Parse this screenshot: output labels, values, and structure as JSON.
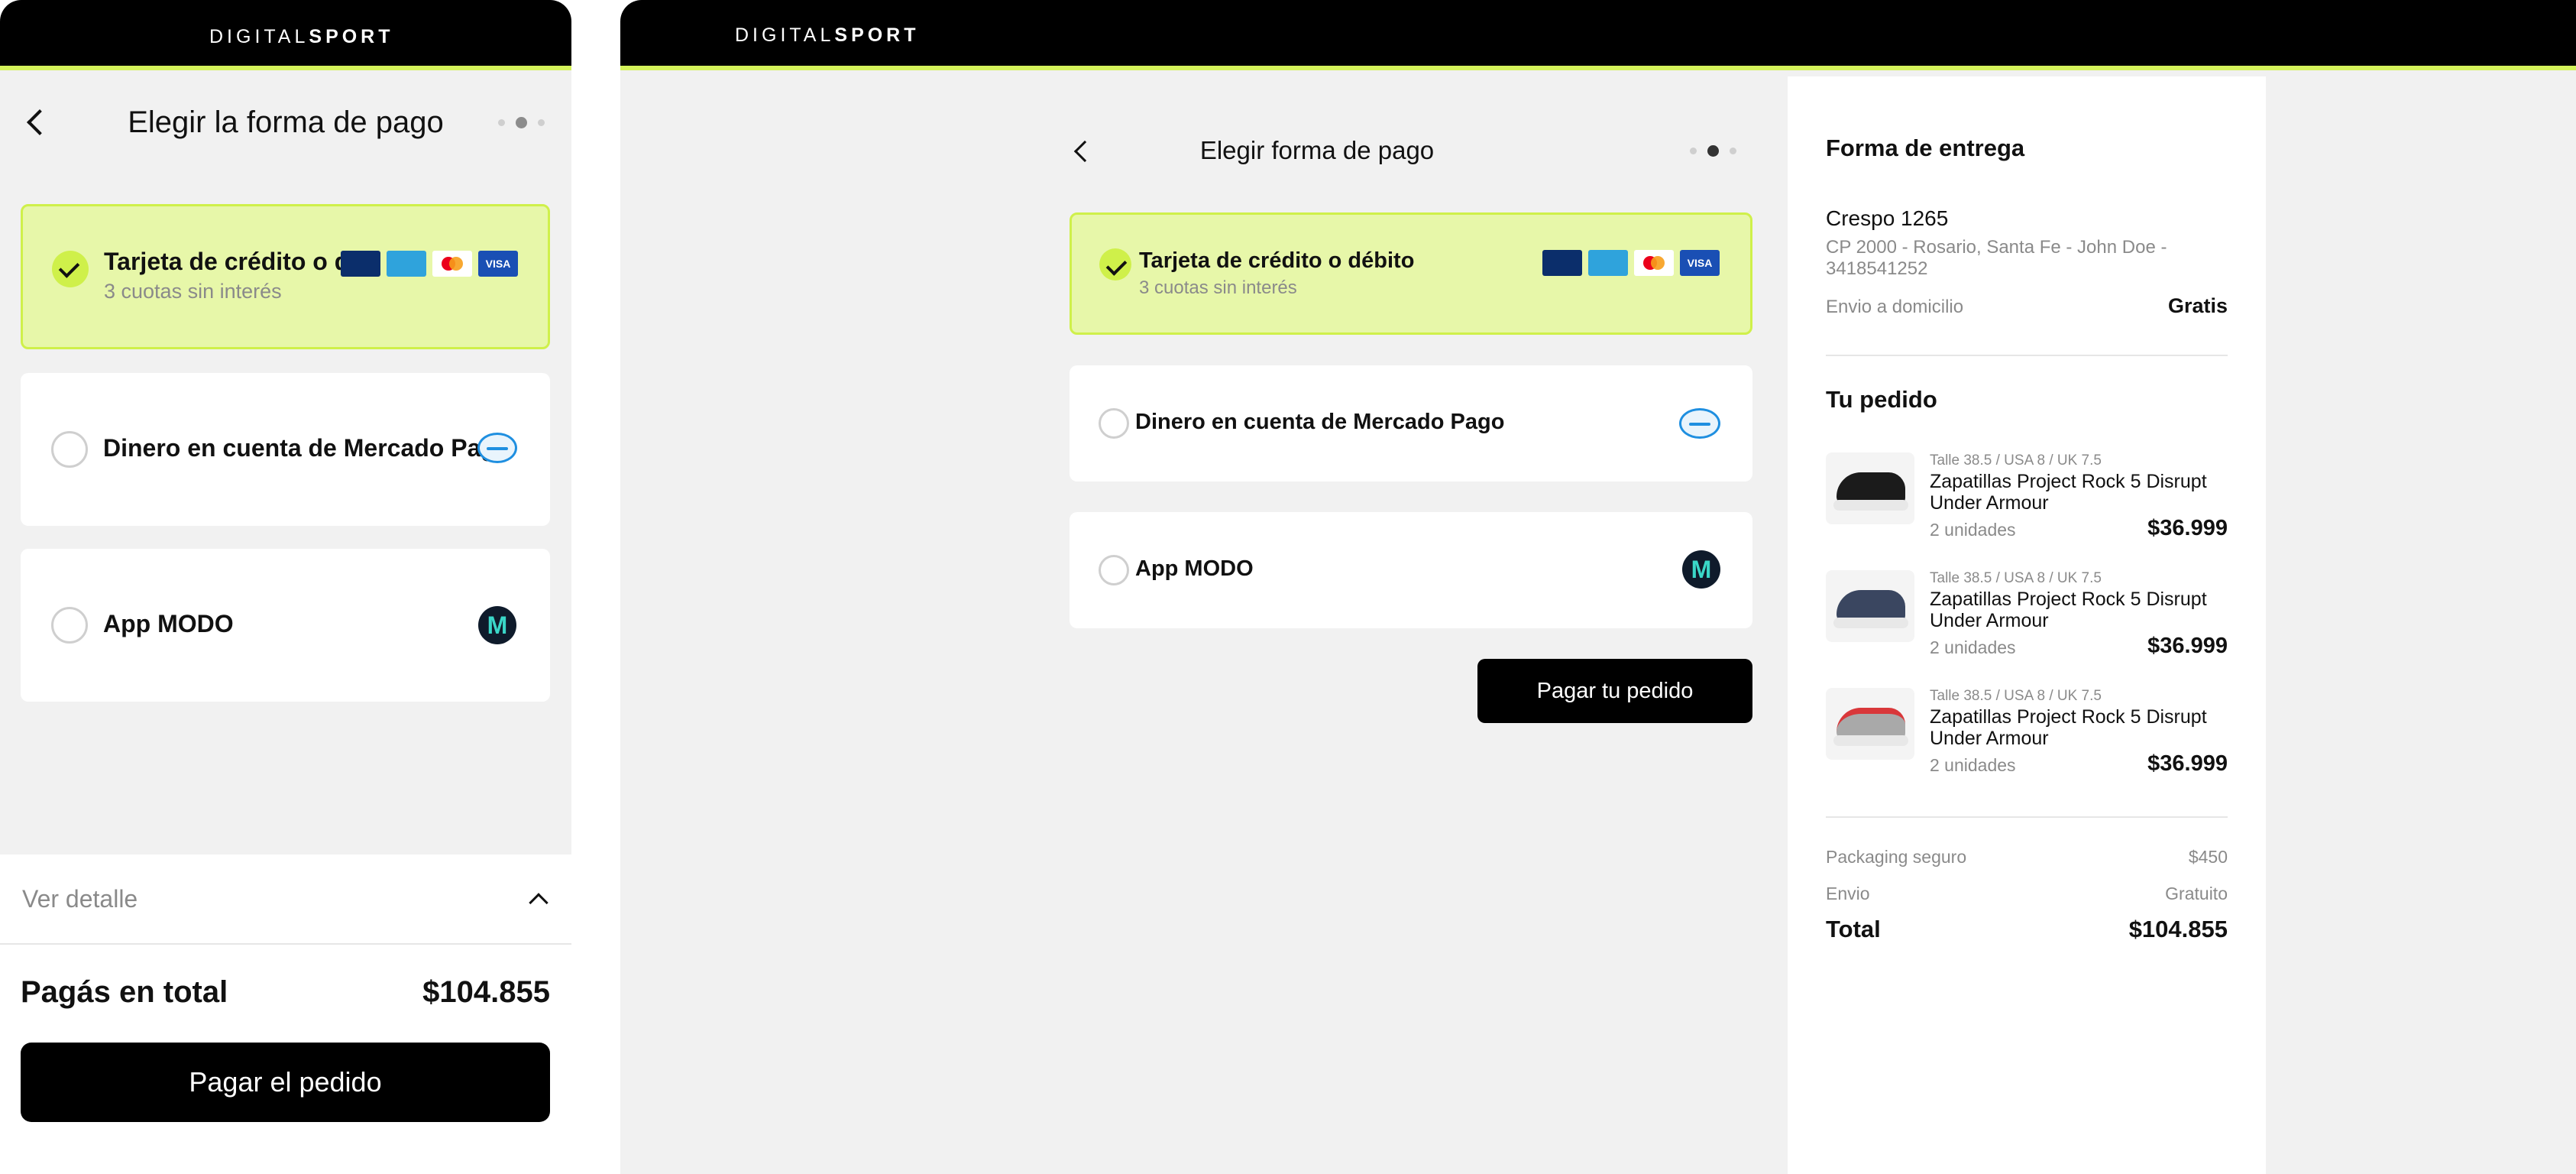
{
  "brand": {
    "logo_light": "DIGITAL",
    "logo_bold": "SPORT"
  },
  "mobile": {
    "title": "Elegir la forma de pago",
    "options": [
      {
        "label": "Tarjeta de crédito o débito",
        "sublabel": "3 cuotas sin interés",
        "selected": true
      },
      {
        "label": "Dinero en cuenta de Mercado Pago",
        "selected": false
      },
      {
        "label": "App MODO",
        "selected": false
      }
    ],
    "details_toggle": "Ver detalle",
    "total_label": "Pagás en total",
    "total_value": "$104.855",
    "pay_button": "Pagar el pedido"
  },
  "desktop": {
    "title": "Elegir forma de pago",
    "options": [
      {
        "label": "Tarjeta de crédito o débito",
        "sublabel": "3 cuotas sin interés",
        "selected": true
      },
      {
        "label": "Dinero en cuenta de Mercado Pago",
        "selected": false
      },
      {
        "label": "App MODO",
        "selected": false
      }
    ],
    "pay_button": "Pagar tu pedido"
  },
  "summary": {
    "delivery_heading": "Forma de entrega",
    "address_line": "Crespo 1265",
    "address_detail_1": "CP 2000 - Rosario, Santa Fe - John Doe -",
    "address_detail_2": "3418541252",
    "shipping_method": "Envio a domicilio",
    "shipping_cost": "Gratis",
    "order_heading": "Tu pedido",
    "items": [
      {
        "size": "Talle 38.5 / USA 8 / UK 7.5",
        "name_1": "Zapatillas Project Rock 5 Disrupt",
        "name_2": "Under Armour",
        "qty": "2 unidades",
        "price": "$36.999"
      },
      {
        "size": "Talle 38.5 / USA 8 / UK 7.5",
        "name_1": "Zapatillas Project Rock 5 Disrupt",
        "name_2": "Under Armour",
        "qty": "2 unidades",
        "price": "$36.999"
      },
      {
        "size": "Talle 38.5 / USA 8 / UK 7.5",
        "name_1": "Zapatillas Project Rock 5 Disrupt",
        "name_2": "Under Armour",
        "qty": "2 unidades",
        "price": "$36.999"
      }
    ],
    "packaging_label": "Packaging seguro",
    "packaging_value": "$450",
    "shipping_label": "Envio",
    "shipping_value": "Gratuito",
    "total_label": "Total",
    "total_value": "$104.855"
  },
  "card_brands": [
    "naranja-x",
    "american-express",
    "mastercard",
    "visa"
  ],
  "card_brand_text": {
    "naranja": "NX",
    "amex": "AMEX",
    "visa": "VISA"
  },
  "modo_letter": "M",
  "colors": {
    "accent": "#d4f25a",
    "selected_bg": "#e7f7a9",
    "black": "#000000",
    "page_bg": "#f1f1f1"
  }
}
